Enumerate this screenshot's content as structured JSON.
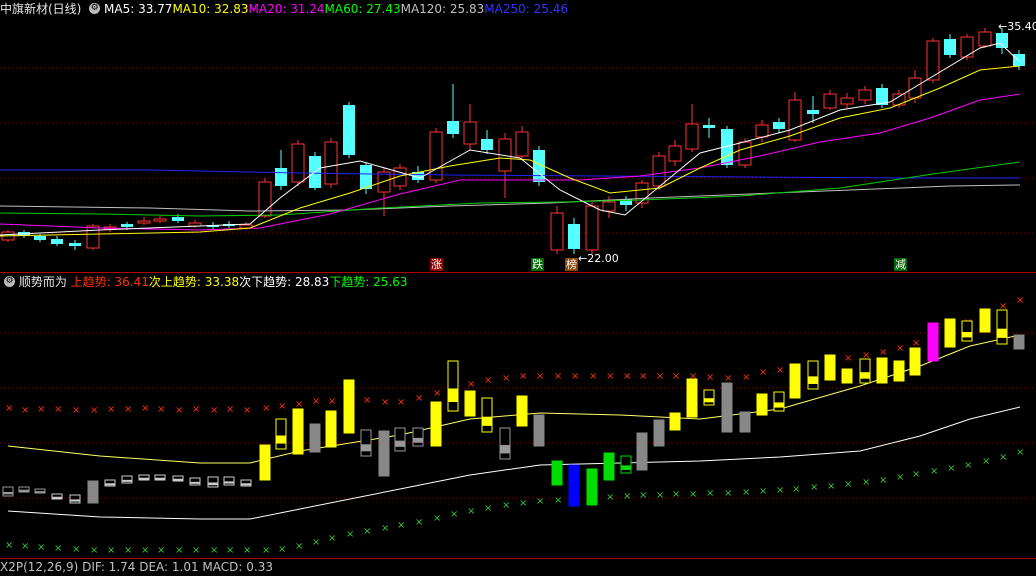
{
  "header": {
    "stock_name": "中旗新材(日线)",
    "ma_items": [
      {
        "label": "MA5: 33.77",
        "color": "#ffffff"
      },
      {
        "label": "MA10: 32.83",
        "color": "#ffff00"
      },
      {
        "label": "MA20: 31.24",
        "color": "#ff00ff"
      },
      {
        "label": "MA60: 27.43",
        "color": "#00ff00"
      },
      {
        "label": "MA120: 25.83",
        "color": "#c0c0c0"
      },
      {
        "label": "MA250: 25.46",
        "color": "#3333ff"
      }
    ]
  },
  "price_annotations": {
    "high_label": "35.40",
    "low_label": "22.00"
  },
  "signals": [
    {
      "text": "涨",
      "bg": "#880000",
      "color": "#ffffff"
    },
    {
      "text": "跌",
      "bg": "#006600",
      "color": "#ffffff"
    },
    {
      "text": "榜",
      "bg": "#884400",
      "color": "#ffffff"
    },
    {
      "text": "减",
      "bg": "#006600",
      "color": "#ffffff"
    }
  ],
  "indicator": {
    "name": "顺势而为",
    "items": [
      {
        "label": "上趋势: 36.41",
        "color": "#ff3300"
      },
      {
        "label": "次上趋势: 33.38",
        "color": "#ffff00"
      },
      {
        "label": "次下趋势: 28.83",
        "color": "#ffffff"
      },
      {
        "label": "下趋势: 25.63",
        "color": "#00ff00"
      }
    ]
  },
  "bottom_legend": "X2P(12,26,9) DIF: 1.74 DEA: 1.01 MACD: 0.33",
  "colors": {
    "up": "#ff3232",
    "down": "#54ffff",
    "ma5": "#ffffff",
    "ma10": "#ffff00",
    "ma20": "#ff00ff",
    "ma60": "#00cc00",
    "ma120": "#c0c0c0",
    "ma250": "#2222ff",
    "grid": "#7a0000"
  }
}
